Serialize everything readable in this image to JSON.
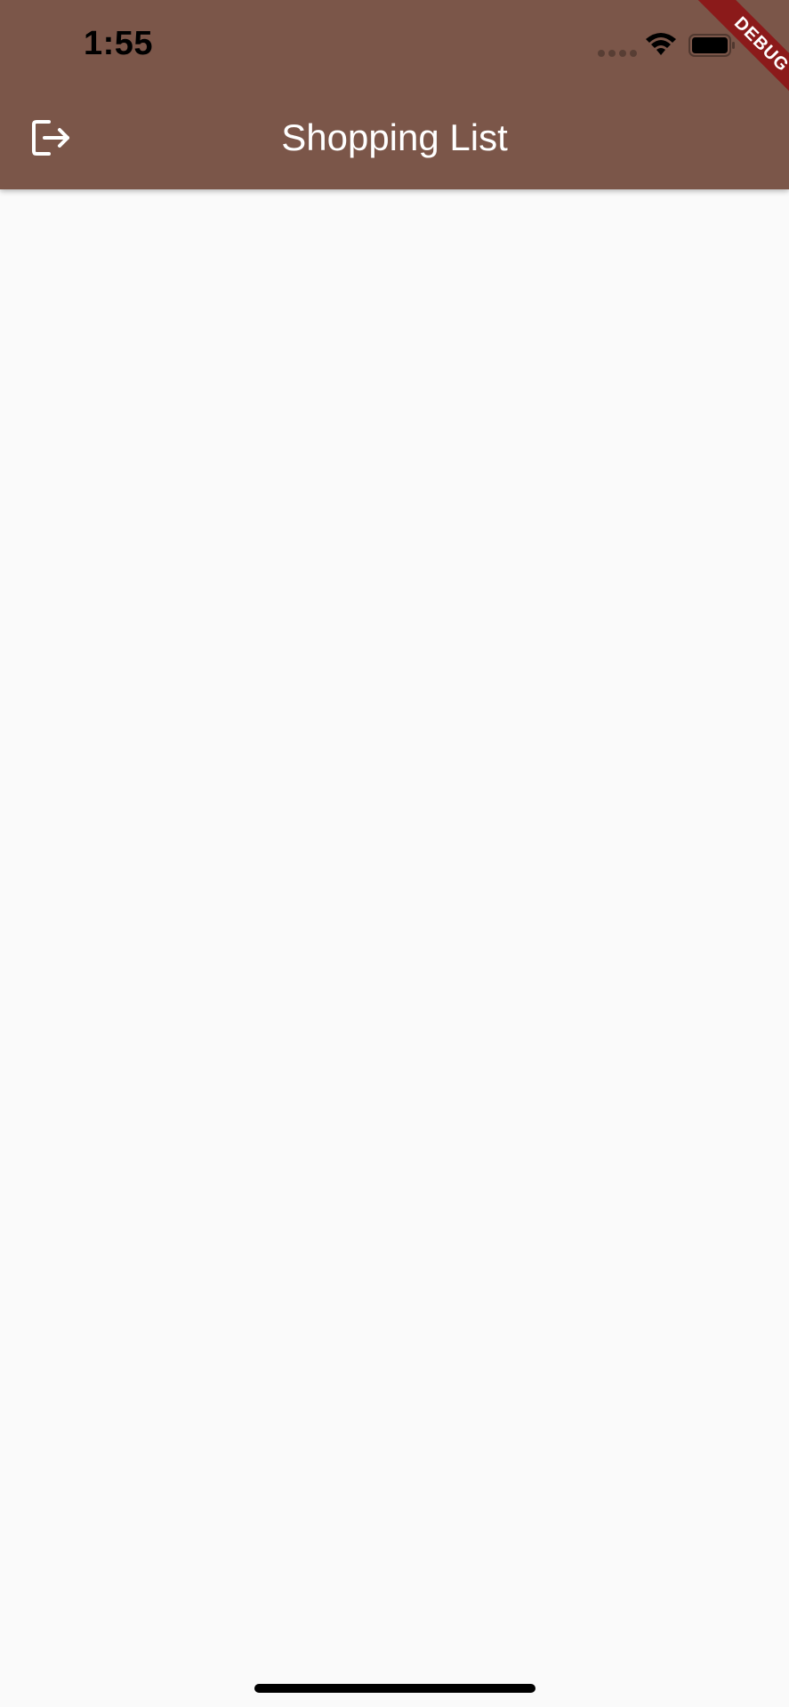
{
  "status_bar": {
    "time": "1:55"
  },
  "app_bar": {
    "title": "Shopping List",
    "background_color": "#7b5649",
    "leading_icon": "logout-icon"
  },
  "debug_banner": {
    "label": "DEBUG",
    "color": "#8b1a1a"
  },
  "theme": {
    "background": "#fafafa",
    "on_primary": "#ffffff"
  }
}
